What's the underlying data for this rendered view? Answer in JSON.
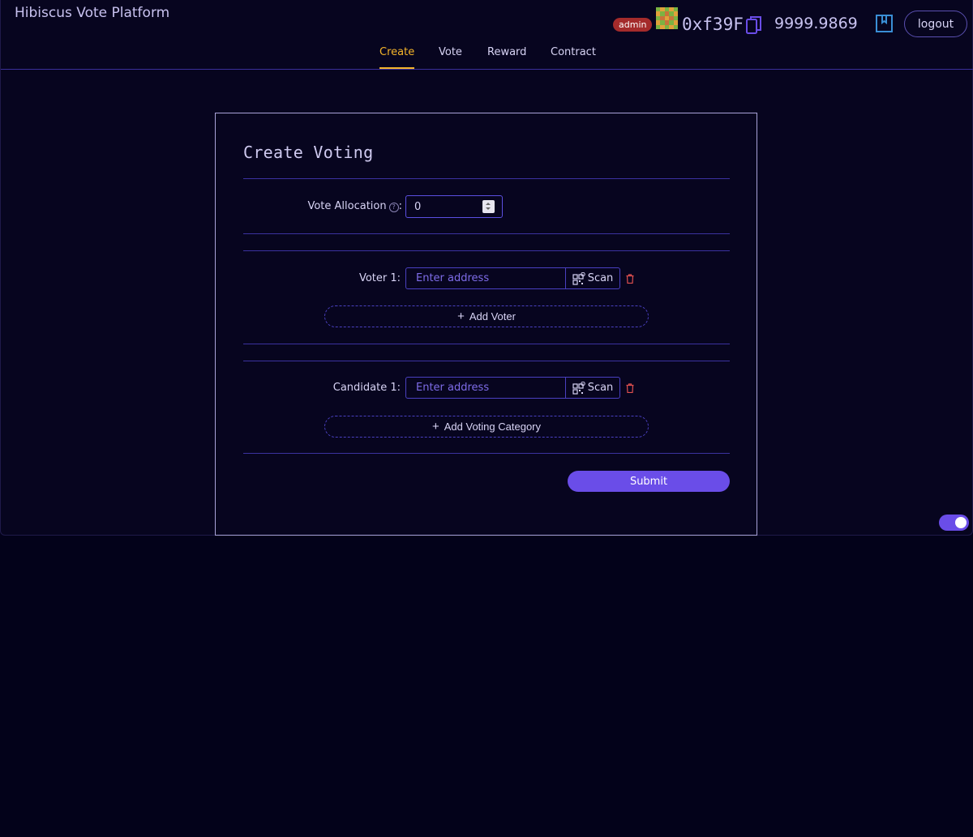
{
  "header": {
    "brand": "Hibiscus Vote Platform",
    "role_badge": "admin",
    "address": "0xf39F",
    "balance": "9999.9869",
    "logout_label": "logout"
  },
  "nav": {
    "tabs": [
      {
        "label": "Create",
        "active": true
      },
      {
        "label": "Vote",
        "active": false
      },
      {
        "label": "Reward",
        "active": false
      },
      {
        "label": "Contract",
        "active": false
      }
    ]
  },
  "form": {
    "title": "Create Voting",
    "vote_allocation": {
      "label": "Vote Allocation",
      "value": "0"
    },
    "voters": [
      {
        "label": "Voter 1:",
        "placeholder": "Enter address",
        "scan_label": "Scan"
      }
    ],
    "add_voter_label": "Add Voter",
    "candidates": [
      {
        "label": "Candidate 1:",
        "placeholder": "Enter address",
        "scan_label": "Scan"
      }
    ],
    "add_category_label": "Add Voting Category",
    "submit_label": "Submit"
  },
  "colors": {
    "accent": "#6a4de8",
    "active_tab": "#f5b52a",
    "badge": "#a42b2b",
    "danger": "#e0504f"
  },
  "icons": [
    "identicon-avatar",
    "copy-icon",
    "bookmark-icon",
    "help-icon",
    "qr-scan-icon",
    "trash-icon",
    "plus-icon",
    "moon-icon"
  ]
}
